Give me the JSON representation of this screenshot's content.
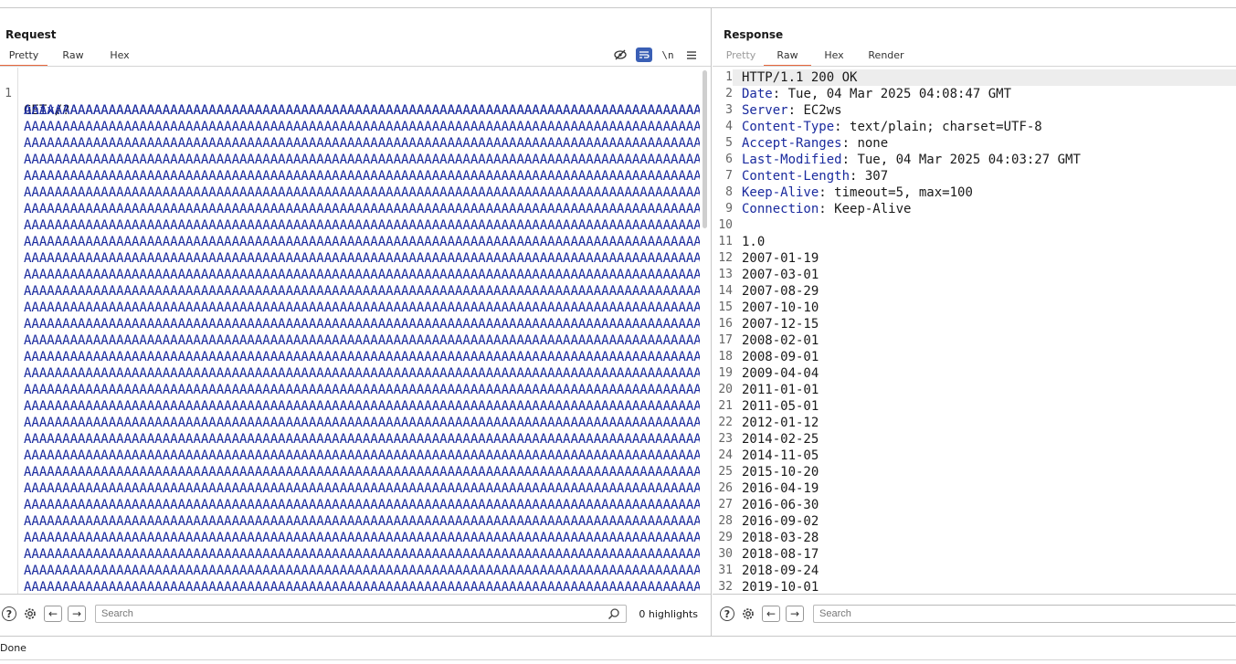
{
  "request": {
    "title": "Request",
    "tabs": [
      {
        "label": "Pretty",
        "active": true,
        "disabled": false
      },
      {
        "label": "Raw",
        "active": false,
        "disabled": false
      },
      {
        "label": "Hex",
        "active": false,
        "disabled": false
      }
    ],
    "toolbar_icons": [
      "hide-nonprintable-icon",
      "wrap-lines-icon",
      "newline-icon",
      "menu-icon"
    ],
    "line_number": "1",
    "first_line": "GET /?",
    "unix_prefix": "unix:",
    "unix_first_run": "AAAAAAAAAAAAAAAAAAAAAAAAAAAAAAAAAAAAAAAAAAAAAAAAAAAAAAAAAAAAAAAAAAAAAAAAAAAAAAAAAAAAAAAAAAAAAAAAAAAAAAAAAAAAAAAAAAAAAAAAAAAAAAAA",
    "a_run": "AAAAAAAAAAAAAAAAAAAAAAAAAAAAAAAAAAAAAAAAAAAAAAAAAAAAAAAAAAAAAAAAAAAAAAAAAAAAAAAAAAAAAAAAAAAAAAAAAAAAAAAAAAAAAAAAAAAAAAAAAAAAAAAAAAAAAAAAAAAAAAAAAAAAAAAAAAAAAAAA",
    "a_line_count": 31,
    "search_placeholder": "Search",
    "highlights": "0 highlights"
  },
  "response": {
    "title": "Response",
    "tabs": [
      {
        "label": "Pretty",
        "active": false,
        "disabled": true
      },
      {
        "label": "Raw",
        "active": true,
        "disabled": false
      },
      {
        "label": "Hex",
        "active": false,
        "disabled": false
      },
      {
        "label": "Render",
        "active": false,
        "disabled": false
      }
    ],
    "lines": [
      {
        "n": "1",
        "name": "",
        "value": "HTTP/1.1 200 OK"
      },
      {
        "n": "2",
        "name": "Date",
        "value": " Tue, 04 Mar 2025 04:08:47 GMT"
      },
      {
        "n": "3",
        "name": "Server",
        "value": " EC2ws"
      },
      {
        "n": "4",
        "name": "Content-Type",
        "value": " text/plain; charset=UTF-8"
      },
      {
        "n": "5",
        "name": "Accept-Ranges",
        "value": " none"
      },
      {
        "n": "6",
        "name": "Last-Modified",
        "value": " Tue, 04 Mar 2025 04:03:27 GMT"
      },
      {
        "n": "7",
        "name": "Content-Length",
        "value": " 307"
      },
      {
        "n": "8",
        "name": "Keep-Alive",
        "value": " timeout=5, max=100"
      },
      {
        "n": "9",
        "name": "Connection",
        "value": " Keep-Alive"
      },
      {
        "n": "10",
        "name": "",
        "value": ""
      },
      {
        "n": "11",
        "name": "",
        "value": "1.0"
      },
      {
        "n": "12",
        "name": "",
        "value": "2007-01-19"
      },
      {
        "n": "13",
        "name": "",
        "value": "2007-03-01"
      },
      {
        "n": "14",
        "name": "",
        "value": "2007-08-29"
      },
      {
        "n": "15",
        "name": "",
        "value": "2007-10-10"
      },
      {
        "n": "16",
        "name": "",
        "value": "2007-12-15"
      },
      {
        "n": "17",
        "name": "",
        "value": "2008-02-01"
      },
      {
        "n": "18",
        "name": "",
        "value": "2008-09-01"
      },
      {
        "n": "19",
        "name": "",
        "value": "2009-04-04"
      },
      {
        "n": "20",
        "name": "",
        "value": "2011-01-01"
      },
      {
        "n": "21",
        "name": "",
        "value": "2011-05-01"
      },
      {
        "n": "22",
        "name": "",
        "value": "2012-01-12"
      },
      {
        "n": "23",
        "name": "",
        "value": "2014-02-25"
      },
      {
        "n": "24",
        "name": "",
        "value": "2014-11-05"
      },
      {
        "n": "25",
        "name": "",
        "value": "2015-10-20"
      },
      {
        "n": "26",
        "name": "",
        "value": "2016-04-19"
      },
      {
        "n": "27",
        "name": "",
        "value": "2016-06-30"
      },
      {
        "n": "28",
        "name": "",
        "value": "2016-09-02"
      },
      {
        "n": "29",
        "name": "",
        "value": "2018-03-28"
      },
      {
        "n": "30",
        "name": "",
        "value": "2018-08-17"
      },
      {
        "n": "31",
        "name": "",
        "value": "2018-09-24"
      },
      {
        "n": "32",
        "name": "",
        "value": "2019-10-01"
      }
    ],
    "search_placeholder": "Search"
  },
  "status": {
    "text": "Done"
  },
  "colors": {
    "accent": "#e8673c",
    "key_blue": "#1a2a9e",
    "toggle_on": "#3a5fb5"
  }
}
